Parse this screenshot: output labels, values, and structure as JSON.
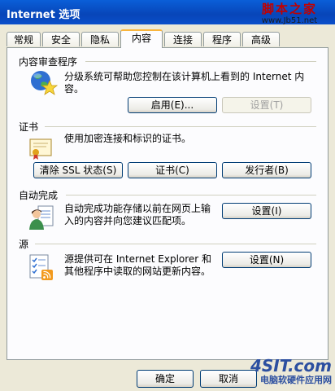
{
  "window": {
    "title": "Internet 选项"
  },
  "watermark": {
    "line1": "脚本之家",
    "line2": "www.Jb51.net"
  },
  "tabs": [
    {
      "label": "常规"
    },
    {
      "label": "安全"
    },
    {
      "label": "隐私"
    },
    {
      "label": "内容",
      "active": true
    },
    {
      "label": "连接"
    },
    {
      "label": "程序"
    },
    {
      "label": "高级"
    }
  ],
  "content_advisor": {
    "title": "内容审查程序",
    "desc_line1": "分级系统可帮助您控制在该计算机上看到的 Internet 内",
    "desc_line2": "容。",
    "enable_label": "启用(E)...",
    "settings_label": "设置(T)"
  },
  "certificates": {
    "title": "证书",
    "desc": "使用加密连接和标识的证书。",
    "clear_ssl_label": "清除 SSL 状态(S)",
    "certificates_label": "证书(C)",
    "publishers_label": "发行者(B)"
  },
  "autocomplete": {
    "title": "自动完成",
    "desc_line1": "自动完成功能存储以前在网页上输",
    "desc_line2": "入的内容并向您建议匹配项。",
    "settings_label": "设置(I)"
  },
  "feeds": {
    "title": "源",
    "desc_line1": "源提供可在 Internet Explorer 和",
    "desc_line2": "其他程序中读取的网站更新内容。",
    "settings_label": "设置(N)"
  },
  "footer": {
    "ok_label": "确定",
    "cancel_label": "取消"
  },
  "brand": {
    "line1": "4SIT.com",
    "line2": "电脑软硬件应用网"
  }
}
